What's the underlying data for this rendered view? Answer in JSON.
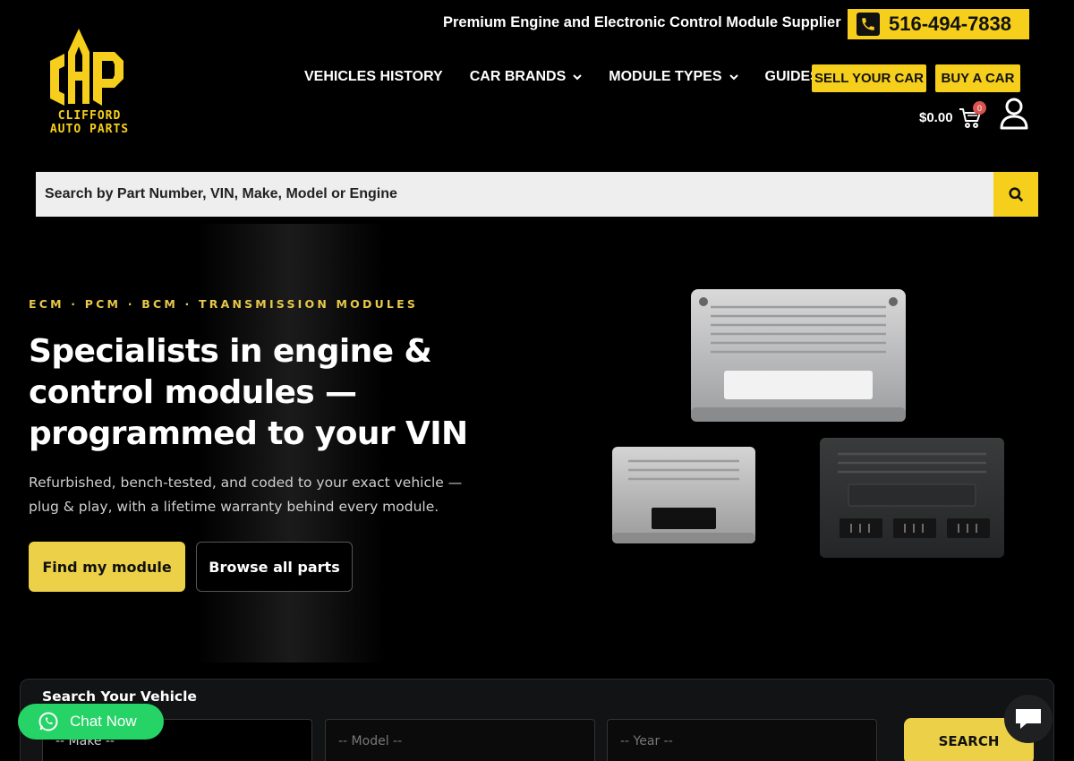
{
  "brand": {
    "logo_letters": "CAP",
    "logo_line1": "CLIFFORD",
    "logo_line2": "AUTO PARTS"
  },
  "header": {
    "tagline": "Premium Engine and Electronic Control Module Supplier",
    "phone": "516-494-7838",
    "nav": [
      {
        "label": "VEHICLES HISTORY",
        "dropdown": false
      },
      {
        "label": "CAR BRANDS",
        "dropdown": true
      },
      {
        "label": "MODULE TYPES",
        "dropdown": true
      },
      {
        "label": "GUIDES",
        "dropdown": false
      }
    ],
    "sell_label": "SELL YOUR CAR",
    "buy_label": "BUY A CAR",
    "cart_amount": "$0.00",
    "cart_count": "0"
  },
  "search": {
    "placeholder": "Search by Part Number, VIN, Make, Model or Engine"
  },
  "hero": {
    "eyebrow": "ECM · PCM · BCM · TRANSMISSION MODULES",
    "headline": "Specialists in engine & control modules — programmed to your VIN",
    "subtext": "Refurbished, bench-tested, and coded to your exact vehicle — plug & play, with a lifetime warranty behind every module.",
    "primary_cta": "Find my module",
    "secondary_cta": "Browse all parts"
  },
  "vehicle_search": {
    "title": "Search Your Vehicle",
    "make_placeholder": "-- Make --",
    "model_placeholder": "-- Model --",
    "year_placeholder": "-- Year --",
    "button": "SEARCH"
  },
  "chat": {
    "label": "Chat Now"
  },
  "colors": {
    "accent": "#f5cf1b",
    "background": "#000000",
    "chat_green": "#25d366"
  }
}
